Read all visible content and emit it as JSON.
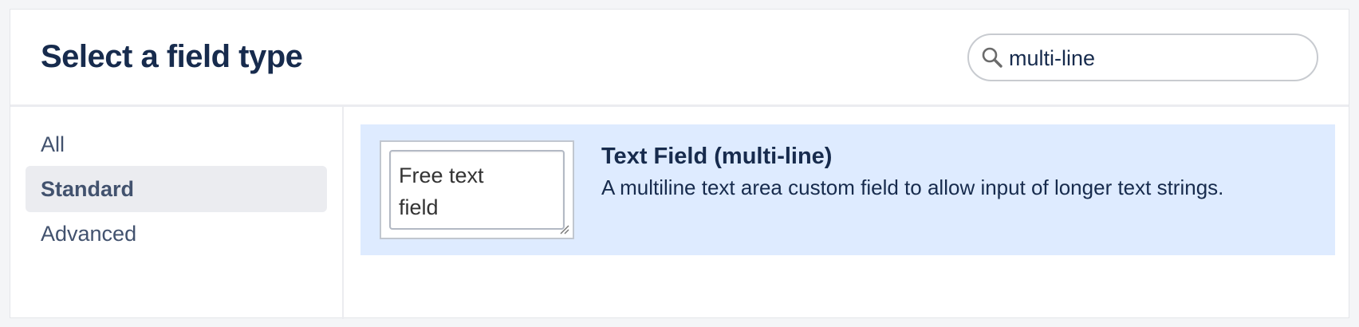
{
  "dialog": {
    "title": "Select a field type",
    "search": {
      "value": "multi-line",
      "icon": "search-icon"
    }
  },
  "sidebar": {
    "items": [
      {
        "label": "All",
        "selected": false
      },
      {
        "label": "Standard",
        "selected": true
      },
      {
        "label": "Advanced",
        "selected": false
      }
    ]
  },
  "results": [
    {
      "preview_text": "Free text\nfield",
      "title": "Text Field (multi-line)",
      "description": "A multiline text area custom field to allow input of longer text strings."
    }
  ],
  "colors": {
    "result_highlight": "#deebff",
    "sidebar_selected": "#ebecf0",
    "text_primary": "#172b4d",
    "text_secondary": "#42526e"
  }
}
